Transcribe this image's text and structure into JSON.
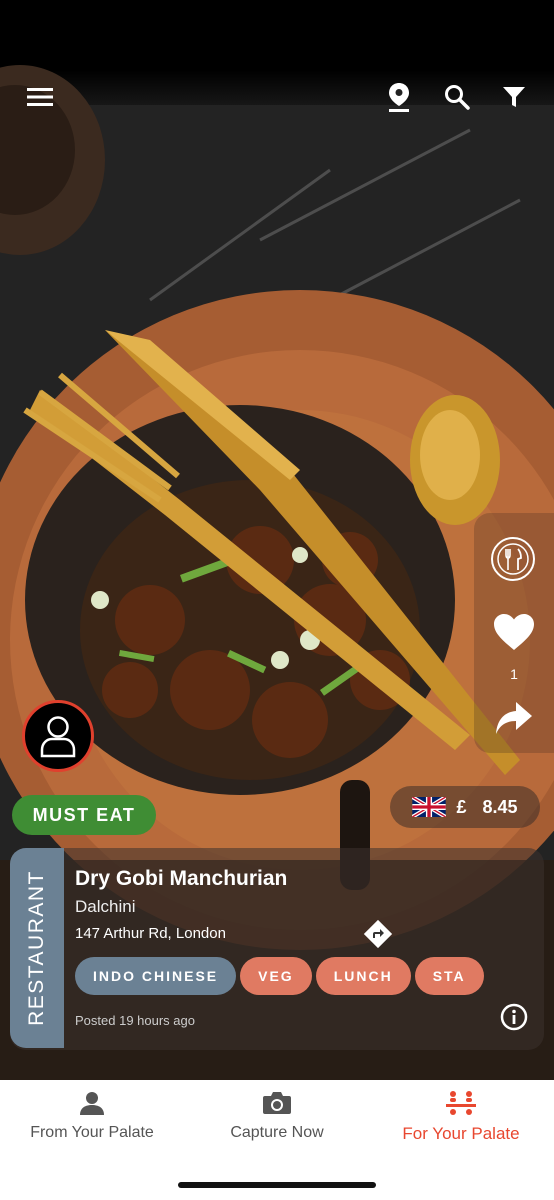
{
  "header": {
    "menu_icon": "hamburger-menu-icon",
    "location_icon": "location-pin-icon",
    "search_icon": "search-icon",
    "filter_icon": "filter-icon"
  },
  "actions": {
    "cutlery_icon": "fork-knife-icon",
    "like_icon": "heart-icon",
    "like_count": "1",
    "share_icon": "share-icon"
  },
  "post": {
    "must_eat_label": "MUST EAT",
    "currency_symbol": "£",
    "price": "8.45",
    "flag": "uk-flag",
    "category_label": "RESTAURANT",
    "dish_name": "Dry Gobi Manchurian",
    "restaurant_name": "Dalchini",
    "address": "147 Arthur Rd, London",
    "tags": [
      "INDO CHINESE",
      "VEG",
      "LUNCH",
      "STA"
    ],
    "posted": "Posted 19 hours ago"
  },
  "bottom_nav": {
    "items": [
      {
        "label": "From Your Palate",
        "icon": "person-icon"
      },
      {
        "label": "Capture Now",
        "icon": "camera-icon"
      },
      {
        "label": "For Your Palate",
        "icon": "people-table-icon"
      }
    ]
  },
  "colors": {
    "accent": "#e8472f",
    "must_eat": "#3f8d34",
    "tag_type": "#6b8194",
    "tag_diet": "#e07a62"
  }
}
